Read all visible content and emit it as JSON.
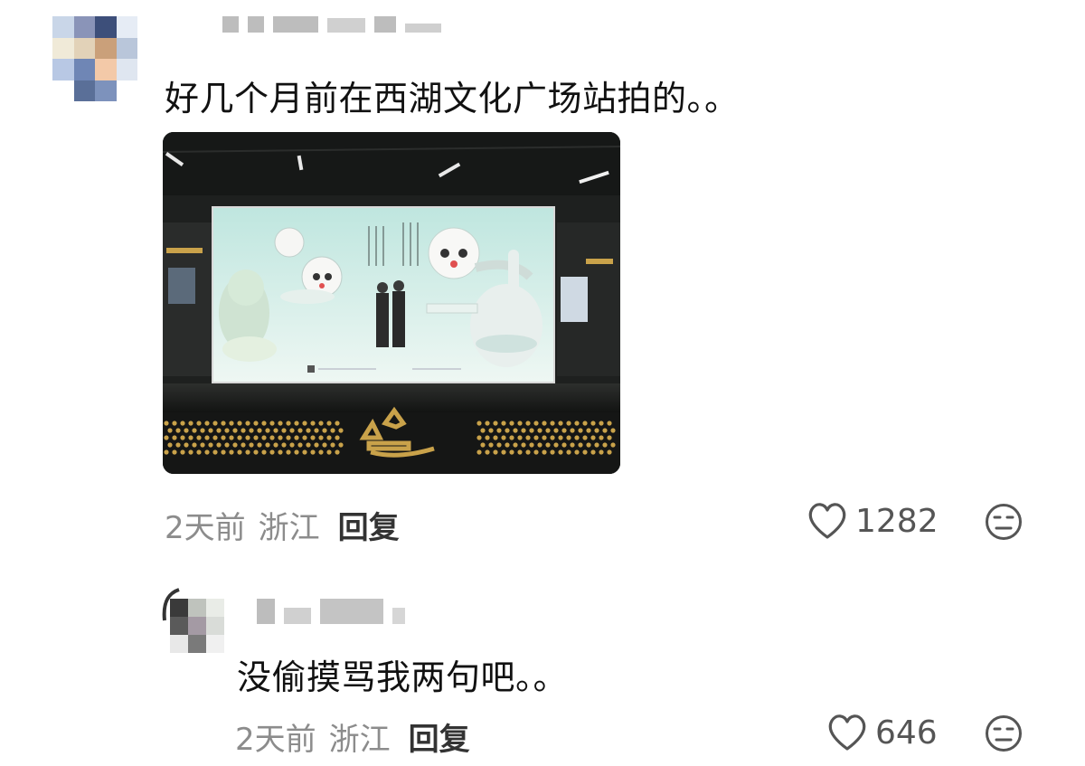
{
  "comment": {
    "avatar_colors": [
      "#c9d6e8",
      "#8a94b8",
      "#3d4f7a",
      "#e6ecf5",
      "#f0ead8",
      "#e2d2b8",
      "#caa07a",
      "#b9c6da",
      "#b8c8e4",
      "#6f86b5",
      "#f3c9a8",
      "#dfe6f0",
      "#ffffff",
      "#5a6f98",
      "#7d92bc",
      "#ffffff"
    ],
    "text": "好几个月前在西湖文化广场站拍的。。",
    "time": "2天前",
    "location": "浙江",
    "reply_label": "回复",
    "likes": "1282"
  },
  "reply": {
    "avatar_colors": [
      "#3a3a3a",
      "#bfc3bd",
      "#e9ece7",
      "#5a5a5a",
      "#a49aa4",
      "#d9dcd8",
      "#e8e8e8",
      "#7a7a7a",
      "#f0f0f0"
    ],
    "text": "没偷摸骂我两句吧。。",
    "time": "2天前",
    "location": "浙江",
    "reply_label": "回复",
    "likes": "646"
  },
  "photo": {
    "icon": "metro-ad-photo",
    "colors": {
      "ad_bg": "#dff2ee",
      "gold": "#c9a24a",
      "frame": "#1b1d1c"
    }
  }
}
